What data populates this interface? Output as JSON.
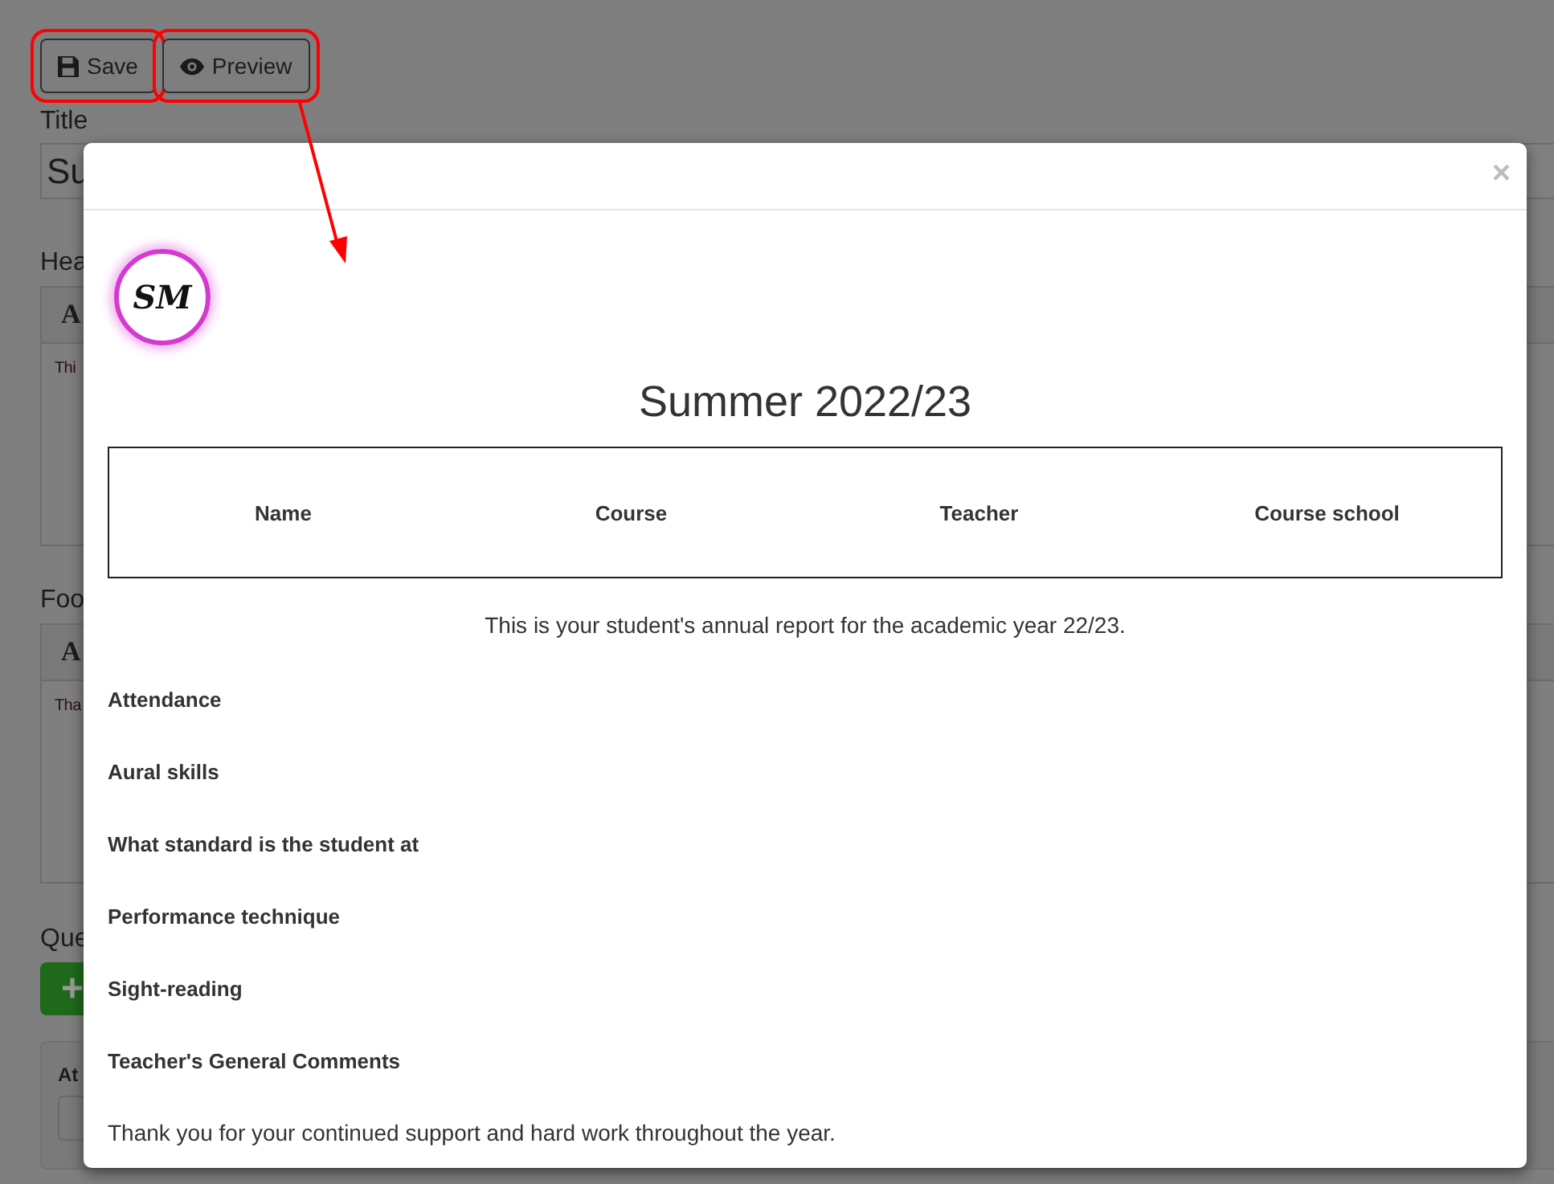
{
  "toolbar": {
    "buttons": [
      {
        "kind": "save",
        "label": "Save",
        "highlighted": true
      },
      {
        "kind": "preview",
        "label": "Preview",
        "highlighted": true
      }
    ]
  },
  "form": {
    "title_label": "Title",
    "title_value": "Su",
    "header_label": "Hea",
    "header_toolbar": "A",
    "header_text": "Thi",
    "footer_label": "Foo",
    "footer_toolbar": "A",
    "footer_text": "Tha",
    "questions_label": "Que",
    "add_button": "+",
    "question_card_label": "At"
  },
  "modal": {
    "close": "×",
    "logo_text": "SM",
    "title": "Summer 2022/23",
    "table": {
      "columns": [
        "Name",
        "Course",
        "Teacher",
        "Course school"
      ]
    },
    "intro": "This is your student's annual report for the academic year 22/23.",
    "sections": [
      "Attendance",
      "Aural skills",
      "What standard is the student at",
      "Performance technique",
      "Sight-reading",
      "Teacher's General Comments"
    ],
    "closing": "Thank you for your continued support and hard work throughout the year."
  }
}
